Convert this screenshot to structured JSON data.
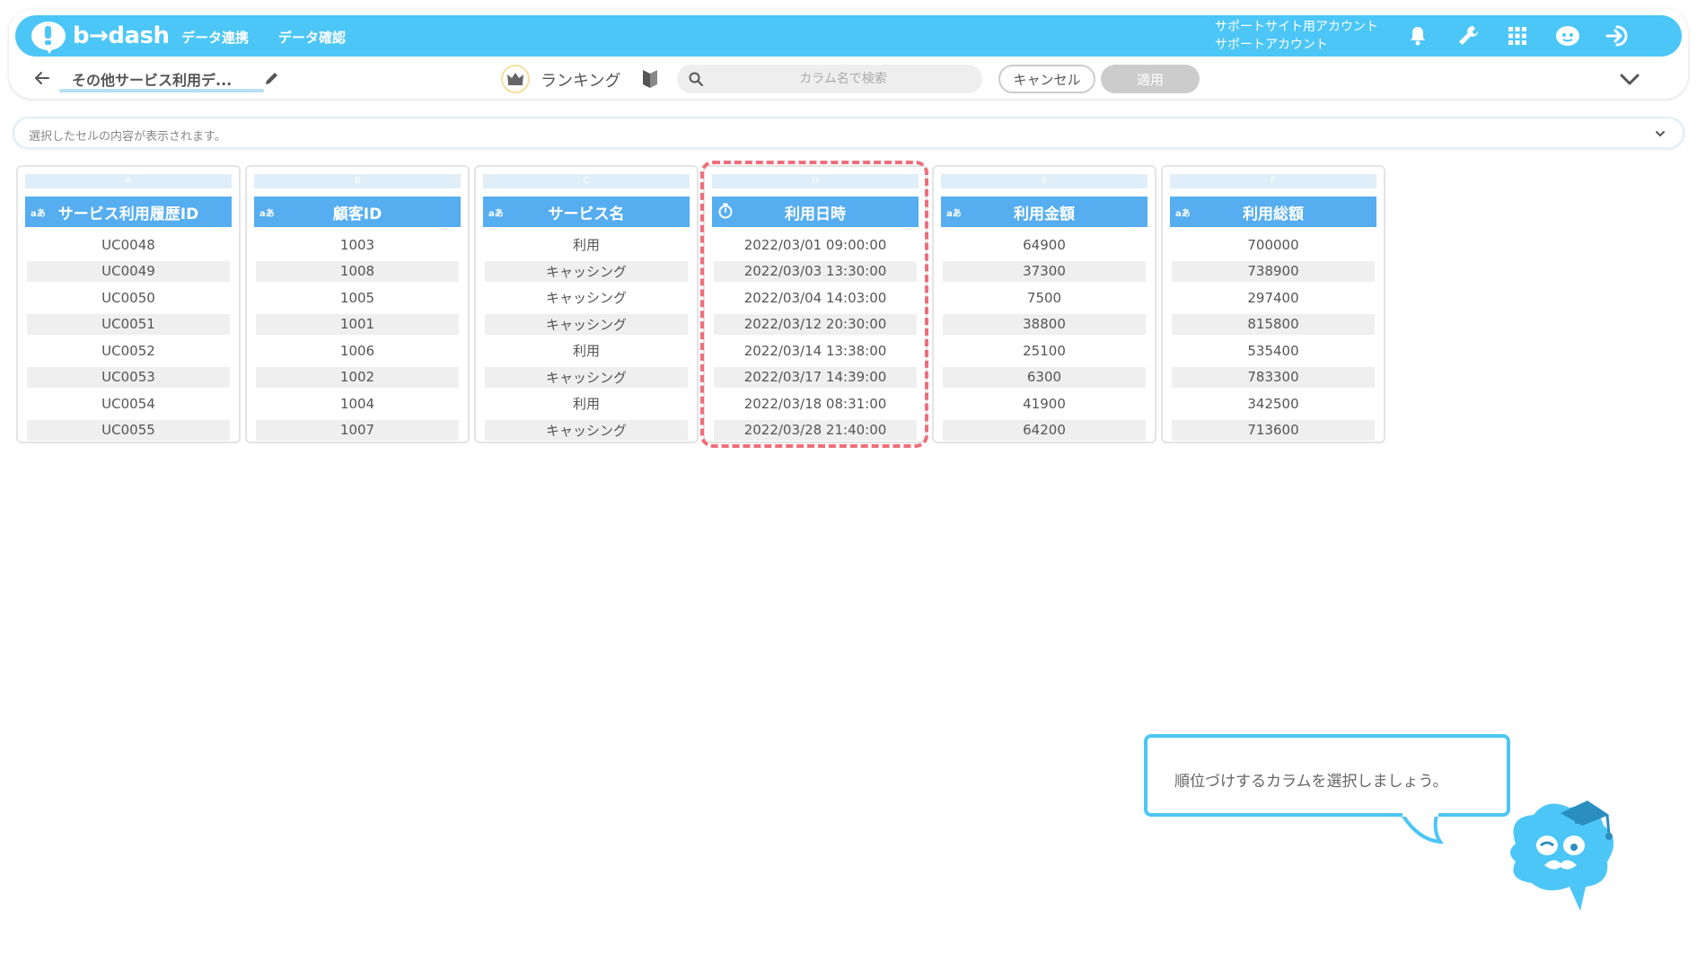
{
  "app": {
    "logo_text": "b→dash",
    "nav": [
      "データ連携",
      "データ確認"
    ],
    "account_line1": "サポートサイト用アカウント",
    "account_line2": "サポートアカウント",
    "icons": [
      "bell-icon",
      "wrench-icon",
      "grid-icon",
      "mascot-help-icon",
      "logout-icon"
    ],
    "accent_color": "#4cc6f6"
  },
  "toolbar": {
    "file_title": "その他サービス利用デ...",
    "ranking_label": "ランキング",
    "search_placeholder": "カラム名で検索",
    "cancel_label": "キャンセル",
    "apply_label": "適用"
  },
  "cell_bar": {
    "placeholder": "選択したセルの内容が表示されます。"
  },
  "columns": [
    {
      "letter": "A",
      "type": "aあ",
      "header": "サービス利用履歴ID",
      "values": [
        "UC0048",
        "UC0049",
        "UC0050",
        "UC0051",
        "UC0052",
        "UC0053",
        "UC0054",
        "UC0055"
      ]
    },
    {
      "letter": "B",
      "type": "aあ",
      "header": "顧客ID",
      "values": [
        "1003",
        "1008",
        "1005",
        "1001",
        "1006",
        "1002",
        "1004",
        "1007"
      ]
    },
    {
      "letter": "C",
      "type": "aあ",
      "header": "サービス名",
      "values": [
        "利用",
        "キャッシング",
        "キャッシング",
        "キャッシング",
        "利用",
        "キャッシング",
        "利用",
        "キャッシング"
      ]
    },
    {
      "letter": "D",
      "type": "timer-icon",
      "header": "利用日時",
      "values": [
        "2022/03/01 09:00:00",
        "2022/03/03 13:30:00",
        "2022/03/04 14:03:00",
        "2022/03/12 20:30:00",
        "2022/03/14 13:38:00",
        "2022/03/17 14:39:00",
        "2022/03/18 08:31:00",
        "2022/03/28 21:40:00"
      ]
    },
    {
      "letter": "E",
      "type": "aあ",
      "header": "利用金額",
      "values": [
        "64900",
        "37300",
        "7500",
        "38800",
        "25100",
        "6300",
        "41900",
        "64200"
      ]
    },
    {
      "letter": "F",
      "type": "aあ",
      "header": "利用総額",
      "values": [
        "700000",
        "738900",
        "297400",
        "815800",
        "535400",
        "783300",
        "342500",
        "713600"
      ]
    }
  ],
  "tooltip": {
    "text": "順位づけするカラムを選択しましょう。"
  }
}
